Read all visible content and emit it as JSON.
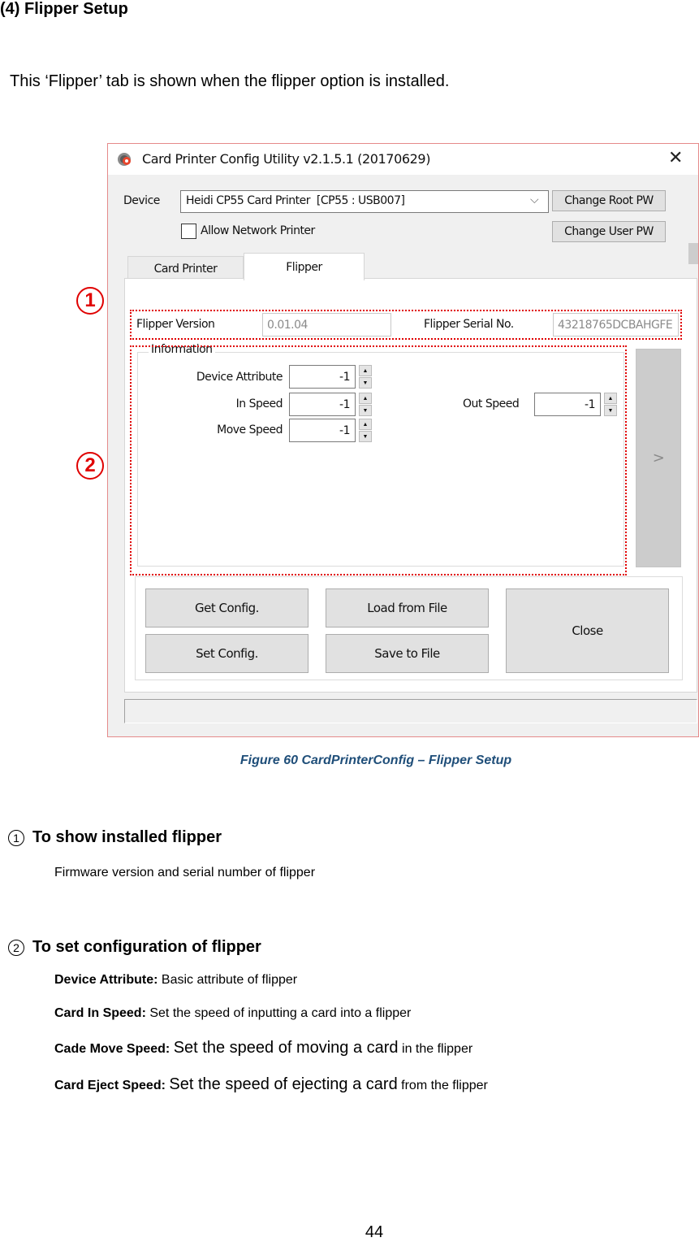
{
  "doc": {
    "section_title": "(4) Flipper Setup",
    "intro": "This ‘Flipper’ tab is shown when the flipper option is installed.",
    "markers": [
      "1",
      "2"
    ],
    "caption": "Figure 60 CardPrinterConfig – Flipper Setup",
    "item1": {
      "num": "1",
      "title": "To show installed flipper",
      "desc": "Firmware version and serial number of flipper"
    },
    "item2": {
      "num": "2",
      "title": "To set configuration of flipper",
      "lines": [
        {
          "term": "Device Attribute:",
          "desc": "Basic attribute of flipper",
          "desc_big": "",
          "desc_tail": ""
        },
        {
          "term": "Card In Speed:",
          "desc": "Set the speed of inputting a card into a flipper",
          "desc_big": "",
          "desc_tail": ""
        },
        {
          "term": "Cade Move Speed:",
          "desc": "",
          "desc_big": "Set the speed of moving a card",
          "desc_tail": "in the flipper"
        },
        {
          "term": "Card Eject Speed:",
          "desc": "",
          "desc_big": "Set the speed of ejecting a card",
          "desc_tail": "from the flipper"
        }
      ]
    },
    "page_number": "44"
  },
  "window": {
    "title": "Card Printer Config Utility v2.1.5.1 (20170629)",
    "icon": "gear-app-icon",
    "close_glyph": "✕",
    "device_label": "Device",
    "device_value": "Heidi CP55 Card Printer  [CP55 : USB007]",
    "allow_network_label": "Allow Network Printer",
    "allow_network_checked": false,
    "change_root_pw": "Change Root PW",
    "change_user_pw": "Change User PW",
    "tabs": [
      {
        "label": "Card Printer",
        "active": false
      },
      {
        "label": "Flipper",
        "active": true
      }
    ],
    "flipper_version_label": "Flipper Version",
    "flipper_version_value": "0.01.04",
    "flipper_serial_label": "Flipper Serial No.",
    "flipper_serial_value": "43218765DCBAHGFE",
    "info_group_label": "Information",
    "fields": {
      "device_attribute": {
        "label": "Device Attribute",
        "value": "-1"
      },
      "in_speed": {
        "label": "In Speed",
        "value": "-1"
      },
      "move_speed": {
        "label": "Move Speed",
        "value": "-1"
      },
      "out_speed": {
        "label": "Out Speed",
        "value": "-1"
      }
    },
    "next_glyph": ">",
    "buttons": {
      "get_config": "Get Config.",
      "set_config": "Set Config.",
      "load_file": "Load from File",
      "save_file": "Save to File",
      "close": "Close"
    },
    "status_text": ""
  },
  "colors": {
    "annotation_red": "#e00000",
    "caption_blue": "#1f4e79"
  }
}
